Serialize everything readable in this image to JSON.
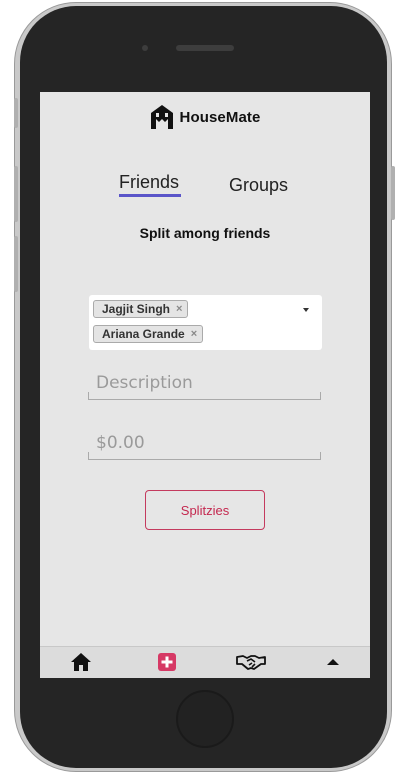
{
  "app": {
    "brand_name": "HouseMate",
    "logo_icon": "house-logo-icon"
  },
  "tabs": [
    {
      "label": "Friends",
      "active": true
    },
    {
      "label": "Groups",
      "active": false
    }
  ],
  "subtitle": "Split among friends",
  "friend_select": {
    "selected": [
      {
        "label": "Jagjit Singh",
        "remove": "×"
      },
      {
        "label": "Ariana Grande",
        "remove": "×"
      }
    ]
  },
  "form": {
    "description_placeholder": "Description",
    "amount_placeholder": "$0.00"
  },
  "action_button": "Splitzies",
  "bottom_nav": [
    {
      "icon": "home-icon"
    },
    {
      "icon": "add-icon",
      "active": true
    },
    {
      "icon": "handshake-icon"
    },
    {
      "icon": "caret-up-icon"
    }
  ],
  "colors": {
    "accent": "#5a55c9",
    "brand_red": "#d63965",
    "screen_bg": "#e6e6e6"
  }
}
